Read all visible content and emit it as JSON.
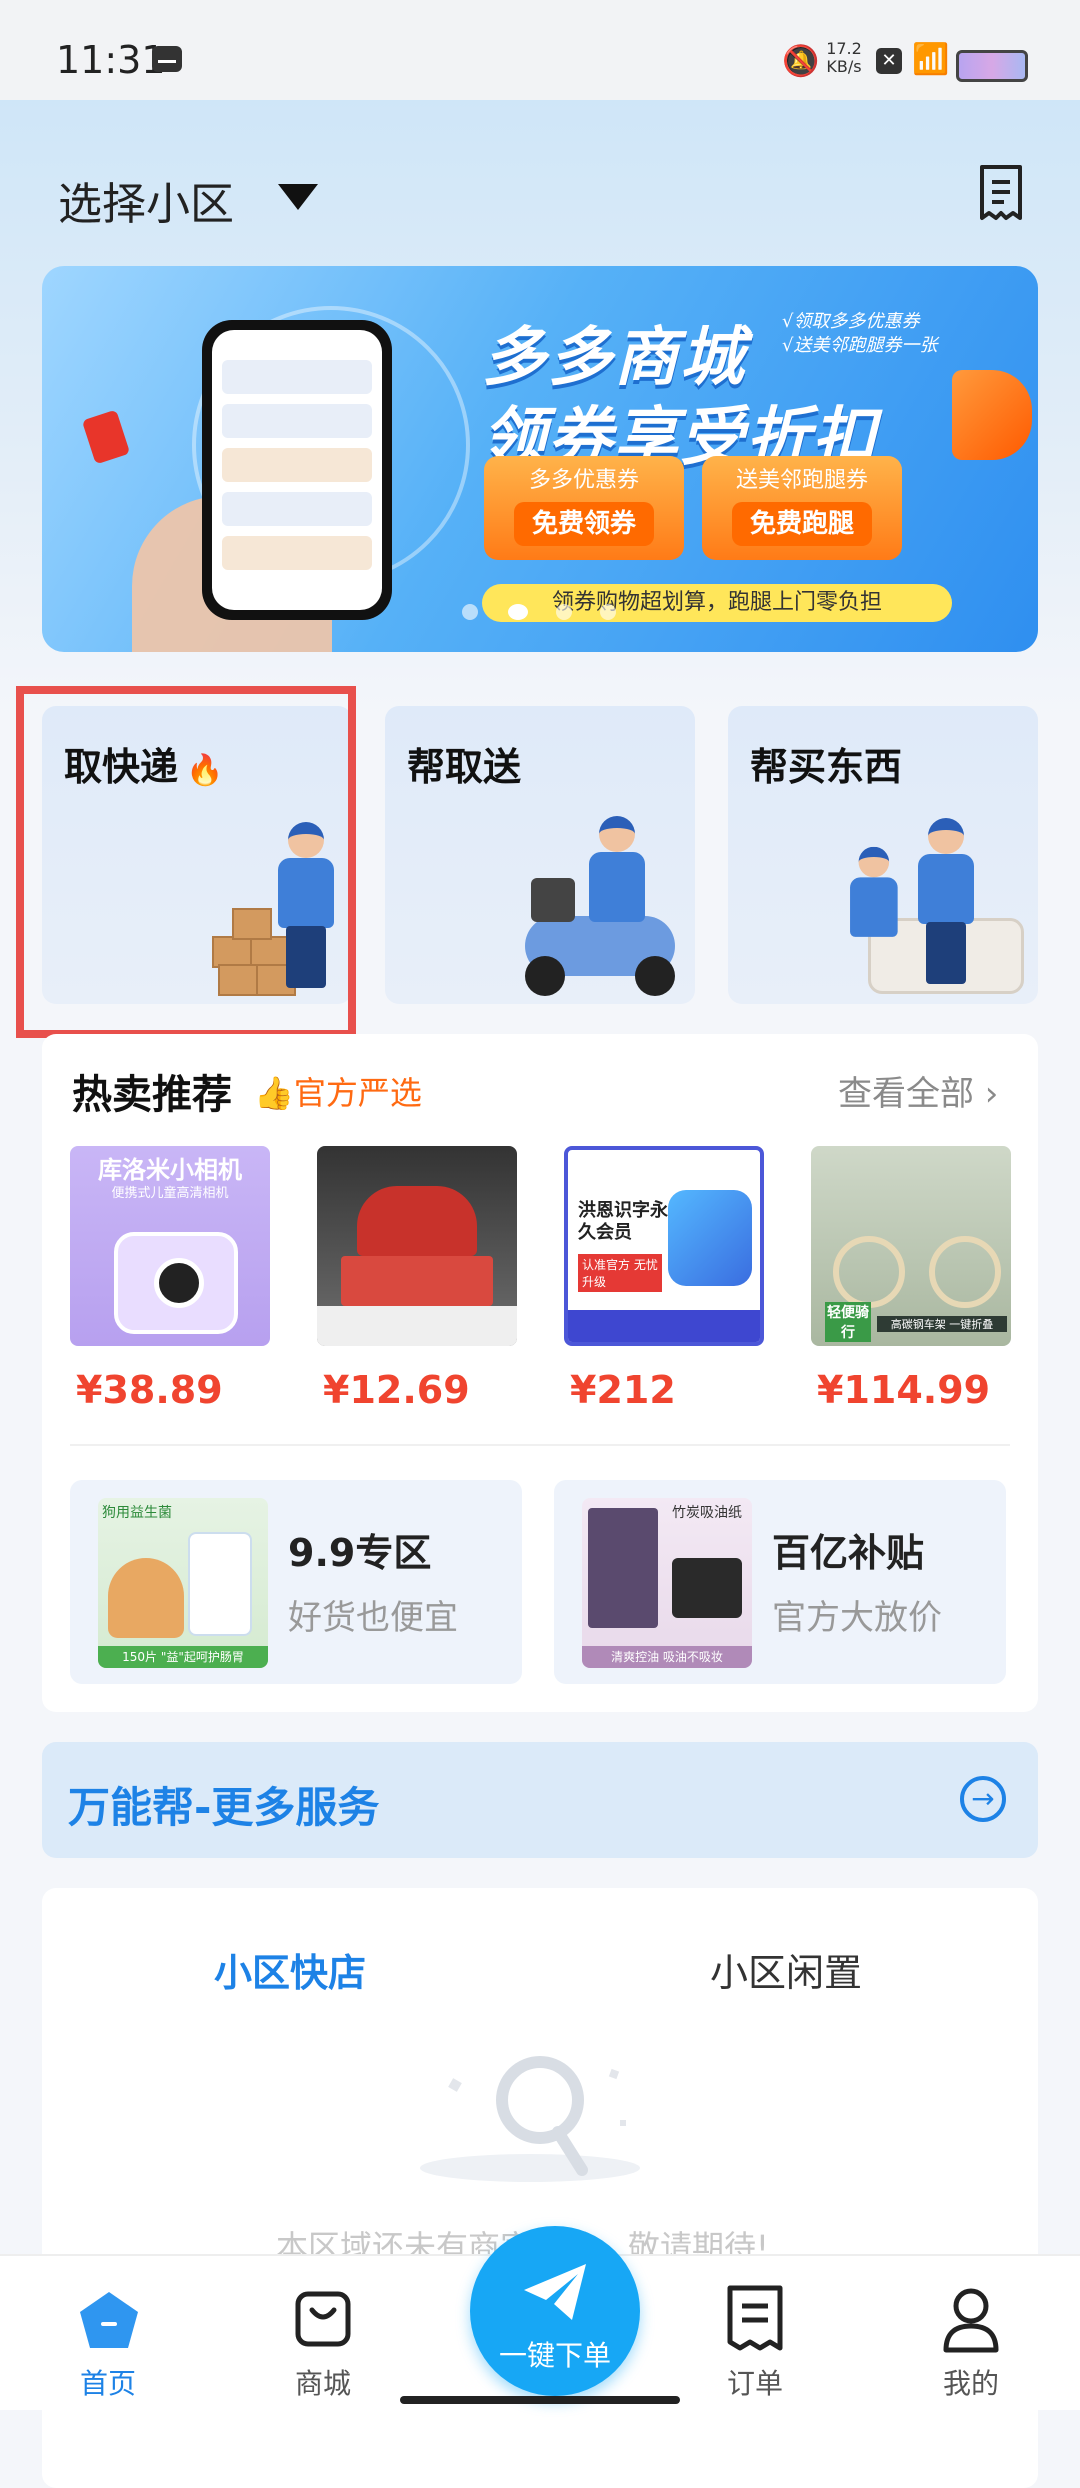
{
  "status_bar": {
    "time": "11:31",
    "net_speed_top": "17.2",
    "net_speed_unit": "KB/s"
  },
  "header": {
    "community_select": "选择小区",
    "icons": {
      "dropdown": "caret-down-icon",
      "orders": "receipt-icon"
    }
  },
  "banner": {
    "title_line1": "多多商城",
    "title_line2": "领券享受折扣",
    "note_line1": "√领取多多优惠券",
    "note_line2": "√送美邻跑腿券一张",
    "coupon1_title": "多多优惠券",
    "coupon1_button": "免费领券",
    "coupon2_title": "送美邻跑腿券",
    "coupon2_button": "免费跑腿",
    "slogan": "领券购物超划算，跑腿上门零负担"
  },
  "services": [
    {
      "label": "取快递"
    },
    {
      "label": "帮取送"
    },
    {
      "label": "帮买东西"
    }
  ],
  "hot": {
    "title": "热卖推荐",
    "badge": "官方严选",
    "view_all": "查看全部 ›",
    "products": [
      {
        "img_caption": "库洛米小相机",
        "img_sub": "便携式儿童高清相机",
        "price": "¥38.89"
      },
      {
        "img_caption": "",
        "img_sub": "",
        "price": "¥12.69"
      },
      {
        "img_caption": "洪恩识字永久会员",
        "img_sub": "认准官方 无忧升级",
        "price": "¥212"
      },
      {
        "img_caption": "轻便骑行",
        "img_sub": "高碳钢车架 一键折叠",
        "price": "¥114.99"
      }
    ],
    "promos": [
      {
        "title": "9.9专区",
        "subtitle": "好货也便宜",
        "img_top": "狗用益生菌",
        "img_bottom": "150片 \"益\"起呵护肠胃"
      },
      {
        "title": "百亿补贴",
        "subtitle": "官方大放价",
        "img_top": "竹炭吸油纸",
        "img_bottom": "清爽控油 吸油不吸妆"
      }
    ]
  },
  "more_services": {
    "label": "万能帮-更多服务"
  },
  "store_tabs": {
    "tab1": "小区快店",
    "tab2": "小区闲置",
    "empty_text": "本区域还未有商家入驻，敬请期待!"
  },
  "bottom_nav": {
    "home": "首页",
    "mall": "商城",
    "order_now": "一键下单",
    "orders": "订单",
    "mine": "我的"
  },
  "colors": {
    "accent": "#1d82e6",
    "price": "#f0442f",
    "badge": "#ff6a12",
    "highlight": "#e8504c"
  }
}
